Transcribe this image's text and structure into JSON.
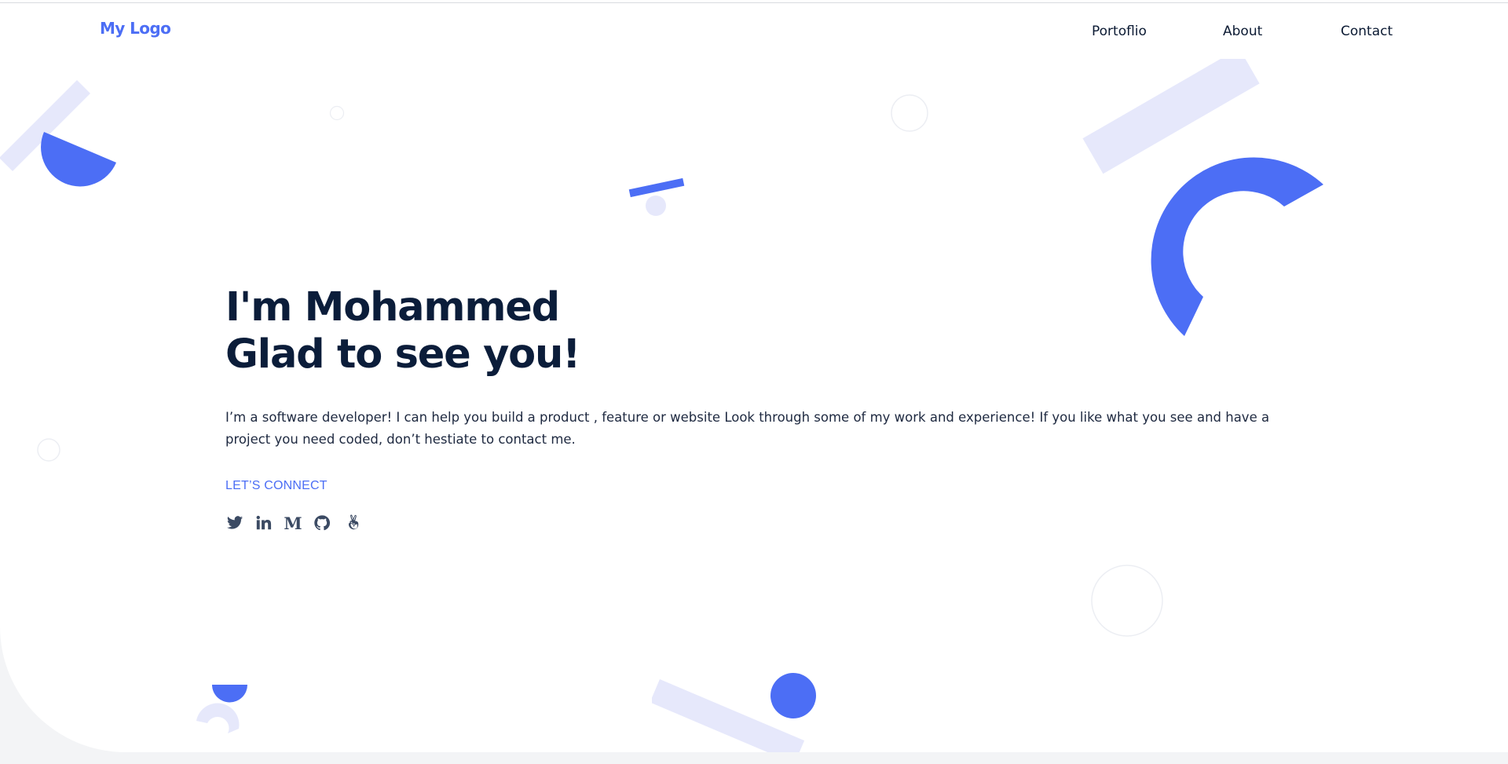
{
  "brand": {
    "logo_text": "My Logo"
  },
  "nav": {
    "items": [
      {
        "label": "Portoflio"
      },
      {
        "label": "About"
      },
      {
        "label": "Contact"
      }
    ]
  },
  "hero": {
    "title_line1": "I'm Mohammed",
    "title_line2": "Glad to see you!",
    "description": "I’m a software developer! I can help you build a product , feature or website Look through some of my work and experience! If you like what you see and have a project you need coded, don’t hestiate to contact me.",
    "cta_label": "LET’S CONNECT"
  },
  "socials": [
    {
      "icon": "twitter-icon"
    },
    {
      "icon": "linkedin-icon"
    },
    {
      "icon": "medium-icon",
      "glyph": "M"
    },
    {
      "icon": "github-icon"
    },
    {
      "icon": "angellist-icon"
    }
  ],
  "colors": {
    "accent": "#4c6ef5",
    "accent_light": "#e6e8fb",
    "heading": "#0b1d3a",
    "text": "#1e2940",
    "icon": "#3b4a63"
  }
}
